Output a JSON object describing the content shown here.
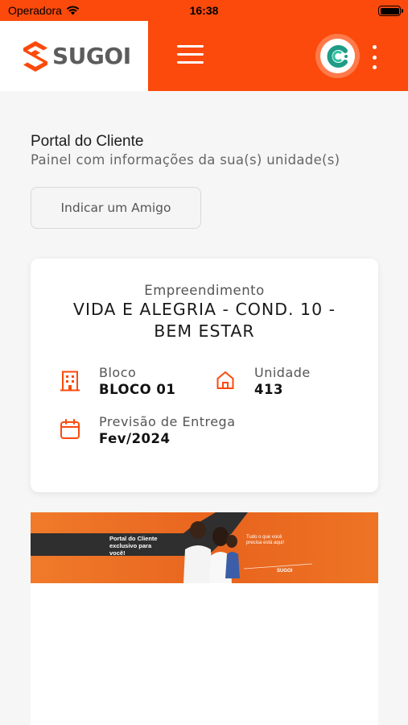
{
  "status_bar": {
    "carrier": "Operadora",
    "time": "16:38"
  },
  "header": {
    "logo_text": "SUGOI",
    "brand_color": "#fb4a0c",
    "icons": [
      "menu-icon",
      "avatar-icon",
      "more-vertical-icon"
    ]
  },
  "page": {
    "title": "Portal do Cliente",
    "subtitle": "Painel com informações da sua(s) unidade(s)",
    "refer_button_label": "Indicar um Amigo"
  },
  "property_card": {
    "project_label": "Empreendimento",
    "project_name": "VIDA E ALEGRIA - COND. 10 - BEM ESTAR",
    "block_label": "Bloco",
    "block_value": "BLOCO 01",
    "unit_label": "Unidade",
    "unit_value": "413",
    "delivery_label": "Previsão de Entrega",
    "delivery_value": "Fev/2024",
    "icons": [
      "building-icon",
      "home-icon",
      "calendar-icon"
    ]
  },
  "banner": {
    "headline": "Portal do Cliente exclusivo para você!",
    "tagline": "Tudo o que você precisa está aqui!",
    "logo_text": "SUGOI"
  }
}
